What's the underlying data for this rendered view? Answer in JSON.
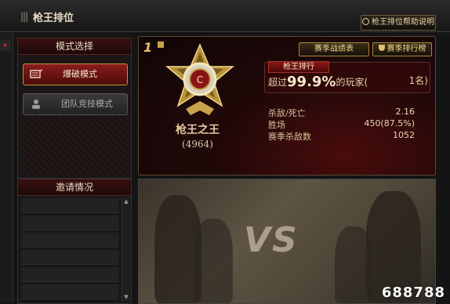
{
  "window": {
    "title": "枪王排位",
    "help_button": "枪王排位帮助说明"
  },
  "mode_select": {
    "heading": "模式选择",
    "modes": [
      {
        "label": "爆破模式",
        "active": true
      },
      {
        "label": "团队竞技模式",
        "active": false
      }
    ]
  },
  "invite": {
    "heading": "邀请情况"
  },
  "profile": {
    "rank_number": "1",
    "title": "枪王之王",
    "score": "(4964)"
  },
  "buttons": {
    "season_record": "赛季战绩表",
    "season_ranking": "赛季排行榜"
  },
  "ranking": {
    "tag": "枪王排行",
    "prefix": "超过",
    "percent": "99.9%",
    "suffix": "的玩家(",
    "place": "1名)"
  },
  "stats": [
    {
      "label": "杀敌/死亡",
      "value": "2.16"
    },
    {
      "label": "胜场",
      "value": "450(87.5%)"
    },
    {
      "label": "赛季杀敌数",
      "value": "1052"
    }
  ],
  "versus": {
    "label": "VS"
  },
  "watermark": "688788",
  "colors": {
    "accent_red": "#8c1c1c",
    "gold": "#e9c46a"
  }
}
